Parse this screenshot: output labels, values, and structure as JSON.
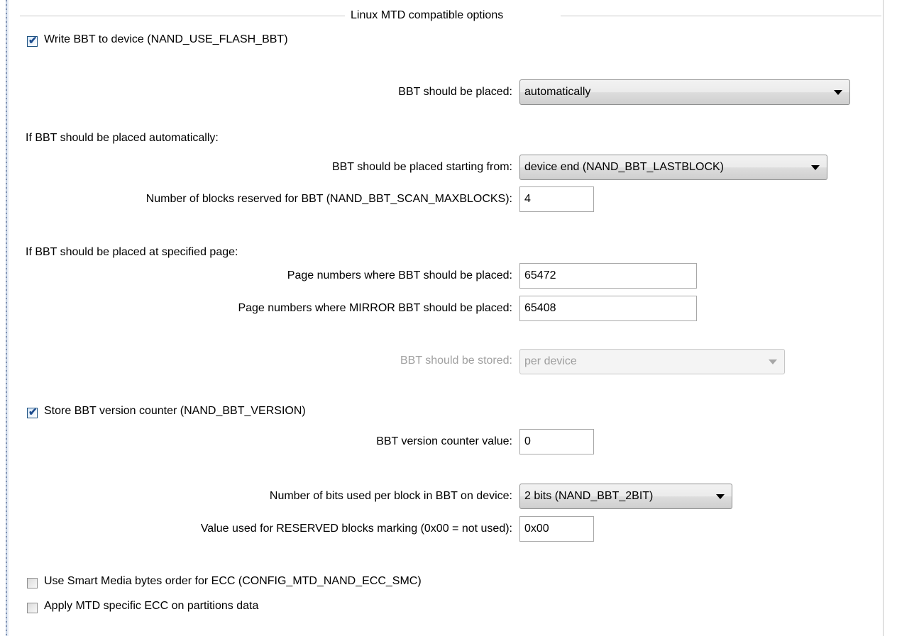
{
  "group": {
    "title": "Linux MTD compatible options"
  },
  "write_bbt": {
    "label": "Write BBT to device (NAND_USE_FLASH_BBT)",
    "checked": true
  },
  "bbt_placed": {
    "label": "BBT should be placed:",
    "value": "automatically"
  },
  "auto_header": "If BBT should be placed automatically:",
  "start_from": {
    "label": "BBT should be placed starting from:",
    "value": "device end (NAND_BBT_LASTBLOCK)"
  },
  "reserved_blocks": {
    "label": "Number of blocks reserved for BBT (NAND_BBT_SCAN_MAXBLOCKS):",
    "value": "4"
  },
  "page_header": "If BBT should be placed at specified page:",
  "page_numbers": {
    "label": "Page numbers where BBT should be placed:",
    "value": "65472"
  },
  "mirror_page_numbers": {
    "label": "Page numbers where MIRROR BBT should be placed:",
    "value": "65408"
  },
  "bbt_stored": {
    "label": "BBT should be stored:",
    "value": "per device",
    "disabled": true
  },
  "store_version": {
    "label": "Store BBT version counter (NAND_BBT_VERSION)",
    "checked": true
  },
  "version_value": {
    "label": "BBT version counter value:",
    "value": "0"
  },
  "bits_per_block": {
    "label": "Number of bits used per block in BBT on device:",
    "value": "2 bits (NAND_BBT_2BIT)"
  },
  "reserved_marking": {
    "label": "Value used for RESERVED blocks marking (0x00 = not used):",
    "value": "0x00"
  },
  "smart_media": {
    "label": "Use Smart Media bytes order for ECC (CONFIG_MTD_NAND_ECC_SMC)",
    "checked": false
  },
  "mtd_ecc": {
    "label": "Apply MTD specific ECC on partitions data",
    "checked": false
  },
  "colors": {
    "checkmark": "#1d4c8d",
    "disabled_text": "#a0a0a0",
    "border": "#c8c8c8"
  },
  "icons": {
    "checkmark": "checkmark-icon",
    "dropdown_arrow": "chevron-down-icon"
  }
}
